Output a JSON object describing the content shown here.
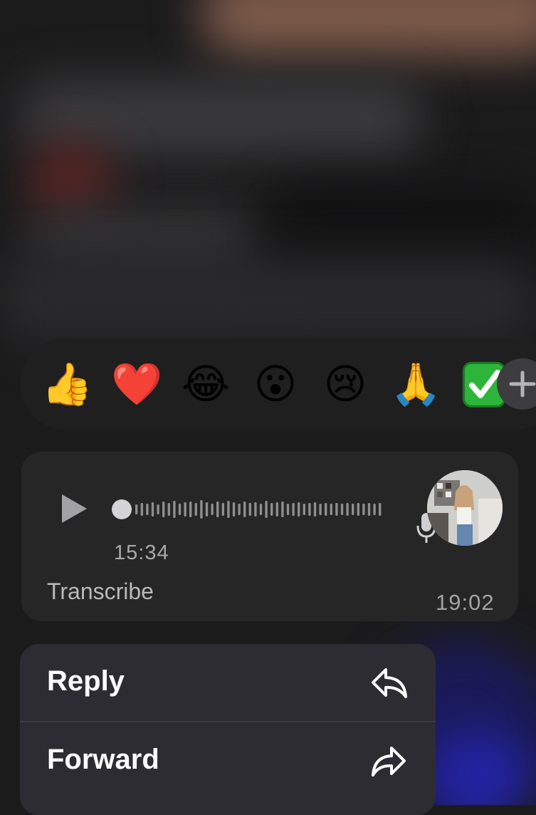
{
  "reactions": {
    "emojis": [
      {
        "icon": "thumbs-up-icon",
        "glyph": "👍"
      },
      {
        "icon": "red-heart-icon",
        "glyph": "❤️"
      },
      {
        "icon": "face-with-tears-of-joy-icon",
        "glyph": "😂"
      },
      {
        "icon": "face-with-open-mouth-icon",
        "glyph": "😮"
      },
      {
        "icon": "crying-face-icon",
        "glyph": "😢"
      },
      {
        "icon": "folded-hands-icon",
        "glyph": "🙏"
      },
      {
        "icon": "check-mark-button-icon",
        "glyph": "✅"
      }
    ],
    "more_icon": "plus-icon"
  },
  "voice_message": {
    "duration": "15:34",
    "transcribe_label": "Transcribe",
    "timestamp": "19:02",
    "playback_progress": 0
  },
  "menu": {
    "items": [
      {
        "label": "Reply",
        "icon": "reply-arrow-icon"
      },
      {
        "label": "Forward",
        "icon": "forward-arrow-icon"
      }
    ]
  },
  "colors": {
    "bubble": "#262627",
    "menu": "#2d2c33",
    "reaction_bar": "#1f1f20",
    "secondary_text": "#a9a9ab"
  }
}
